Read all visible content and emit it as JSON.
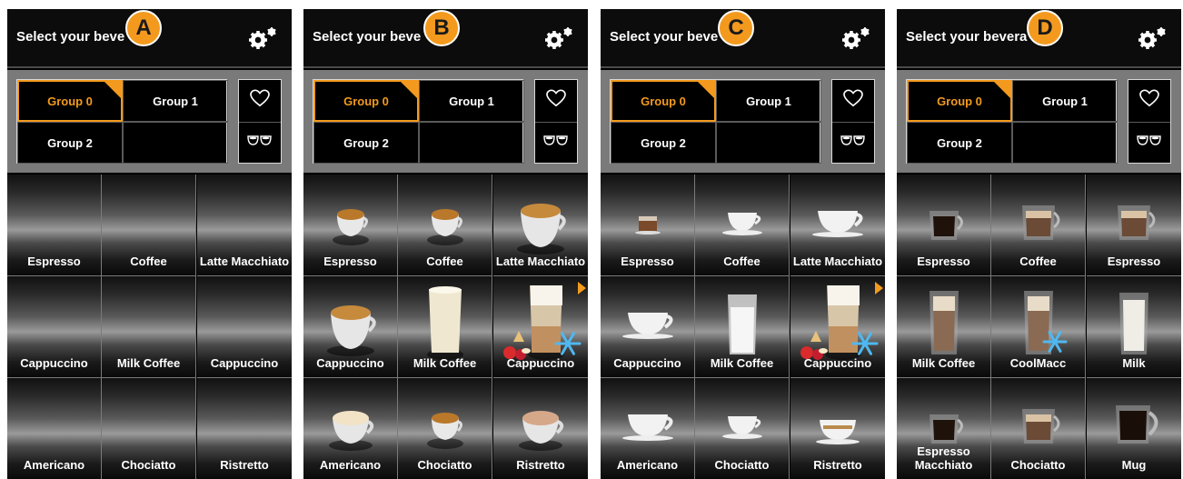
{
  "colors": {
    "accent": "#f39a1e",
    "background": "#000000",
    "separator": "#7a7a7a"
  },
  "icons": {
    "settings": "gears-icon",
    "favorites": "heart-icon",
    "double": "two-cups-icon",
    "cold": "snowflake-icon",
    "more": "arrow-right-icon"
  },
  "panels": [
    {
      "badge": "A",
      "title": "Select your beve",
      "groups": [
        "Group 0",
        "Group 1",
        "Group 2",
        ""
      ],
      "selected_group": 0,
      "tiles": [
        {
          "label": "Espresso",
          "img": "none"
        },
        {
          "label": "Coffee",
          "img": "none"
        },
        {
          "label": "Latte Macchiato",
          "img": "none"
        },
        {
          "label": "Cappuccino",
          "img": "none"
        },
        {
          "label": "Milk Coffee",
          "img": "none"
        },
        {
          "label": "Cappuccino",
          "img": "none"
        },
        {
          "label": "Americano",
          "img": "none"
        },
        {
          "label": "Chociatto",
          "img": "none"
        },
        {
          "label": "Ristretto",
          "img": "none"
        }
      ]
    },
    {
      "badge": "B",
      "title": "Select your beve",
      "groups": [
        "Group 0",
        "Group 1",
        "Group 2",
        ""
      ],
      "selected_group": 0,
      "tiles": [
        {
          "label": "Espresso",
          "img": "cup3d-small"
        },
        {
          "label": "Coffee",
          "img": "cup3d-small"
        },
        {
          "label": "Latte Macchiato",
          "img": "cup3d-big"
        },
        {
          "label": "Cappuccino",
          "img": "cup3d-big"
        },
        {
          "label": "Milk Coffee",
          "img": "glass-milk"
        },
        {
          "label": "Cappuccino",
          "img": "latte-glass-fruit",
          "more": true
        },
        {
          "label": "Americano",
          "img": "cup3d-foam"
        },
        {
          "label": "Chociatto",
          "img": "cup3d-small"
        },
        {
          "label": "Ristretto",
          "img": "cup3d-pink"
        }
      ]
    },
    {
      "badge": "C",
      "title": "Select your beve",
      "groups": [
        "Group 0",
        "Group 1",
        "Group 2",
        ""
      ],
      "selected_group": 0,
      "tiles": [
        {
          "label": "Espresso",
          "img": "shot"
        },
        {
          "label": "Coffee",
          "img": "cup-white-small"
        },
        {
          "label": "Latte Macchiato",
          "img": "cup-white-big"
        },
        {
          "label": "Cappuccino",
          "img": "cup-white-big"
        },
        {
          "label": "Milk Coffee",
          "img": "glass-milk-clear"
        },
        {
          "label": "Cappuccino",
          "img": "latte-glass-fruit",
          "more": true
        },
        {
          "label": "Americano",
          "img": "cup-white-big"
        },
        {
          "label": "Chociatto",
          "img": "cup-white-small"
        },
        {
          "label": "Ristretto",
          "img": "cup-brown-band"
        }
      ]
    },
    {
      "badge": "D",
      "title": "Select your bevera",
      "groups": [
        "Group 0",
        "Group 1",
        "Group 2",
        ""
      ],
      "selected_group": 0,
      "tiles": [
        {
          "label": "Espresso",
          "img": "dglass-dark"
        },
        {
          "label": "Coffee",
          "img": "dglass-cream"
        },
        {
          "label": "Espresso",
          "img": "dglass-cream"
        },
        {
          "label": "Milk Coffee",
          "img": "dglass-tall"
        },
        {
          "label": "CoolMacc",
          "img": "dglass-tall-snow"
        },
        {
          "label": "Milk",
          "img": "dglass-milk"
        },
        {
          "label": "Espresso Macchiato",
          "img": "dglass-dark"
        },
        {
          "label": "Chociatto",
          "img": "dglass-cream"
        },
        {
          "label": "Mug",
          "img": "mug-dark"
        }
      ]
    }
  ]
}
